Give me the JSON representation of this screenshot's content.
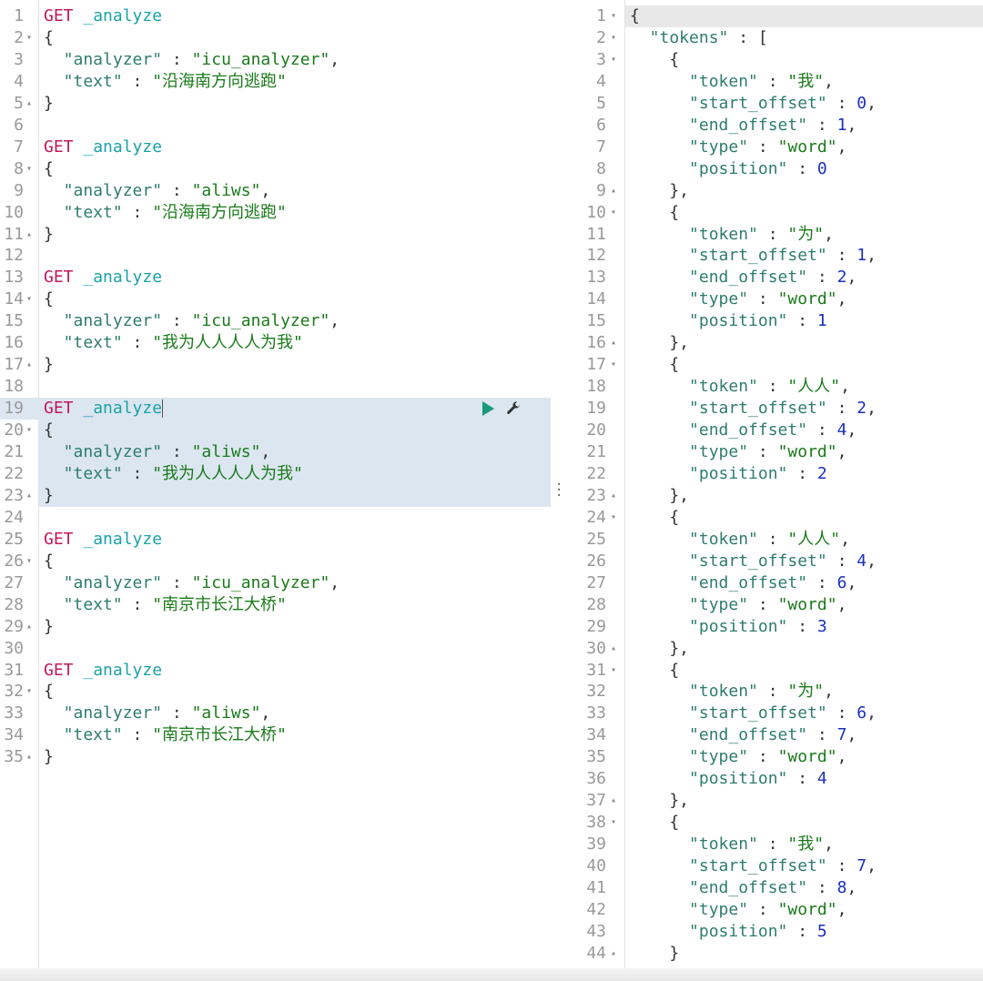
{
  "left_lines": [
    {
      "n": "1",
      "f": "",
      "t": [
        [
          "GET",
          "k-method"
        ],
        [
          " _analyze",
          "k-url"
        ]
      ]
    },
    {
      "n": "2",
      "f": "▾",
      "t": [
        [
          "{",
          "k-punc"
        ]
      ]
    },
    {
      "n": "3",
      "f": "",
      "t": [
        [
          "  \"analyzer\"",
          "k-key"
        ],
        [
          " : ",
          "k-punc"
        ],
        [
          "\"icu_analyzer\"",
          "k-str"
        ],
        [
          ",",
          "k-punc"
        ]
      ]
    },
    {
      "n": "4",
      "f": "",
      "t": [
        [
          "  \"text\"",
          "k-key"
        ],
        [
          " : ",
          "k-punc"
        ],
        [
          "\"沿海南方向逃跑\"",
          "k-str"
        ]
      ]
    },
    {
      "n": "5",
      "f": "▴",
      "t": [
        [
          "}",
          "k-punc"
        ]
      ]
    },
    {
      "n": "6",
      "f": "",
      "t": []
    },
    {
      "n": "7",
      "f": "",
      "t": [
        [
          "GET",
          "k-method"
        ],
        [
          " _analyze",
          "k-url"
        ]
      ]
    },
    {
      "n": "8",
      "f": "▾",
      "t": [
        [
          "{",
          "k-punc"
        ]
      ]
    },
    {
      "n": "9",
      "f": "",
      "t": [
        [
          "  \"analyzer\"",
          "k-key"
        ],
        [
          " : ",
          "k-punc"
        ],
        [
          "\"aliws\"",
          "k-str"
        ],
        [
          ",",
          "k-punc"
        ]
      ]
    },
    {
      "n": "10",
      "f": "",
      "t": [
        [
          "  \"text\"",
          "k-key"
        ],
        [
          " : ",
          "k-punc"
        ],
        [
          "\"沿海南方向逃跑\"",
          "k-str"
        ]
      ]
    },
    {
      "n": "11",
      "f": "▴",
      "t": [
        [
          "}",
          "k-punc"
        ]
      ]
    },
    {
      "n": "12",
      "f": "",
      "t": []
    },
    {
      "n": "13",
      "f": "",
      "t": [
        [
          "GET",
          "k-method"
        ],
        [
          " _analyze",
          "k-url"
        ]
      ]
    },
    {
      "n": "14",
      "f": "▾",
      "t": [
        [
          "{",
          "k-punc"
        ]
      ]
    },
    {
      "n": "15",
      "f": "",
      "t": [
        [
          "  \"analyzer\"",
          "k-key"
        ],
        [
          " : ",
          "k-punc"
        ],
        [
          "\"icu_analyzer\"",
          "k-str"
        ],
        [
          ",",
          "k-punc"
        ]
      ]
    },
    {
      "n": "16",
      "f": "",
      "t": [
        [
          "  \"text\"",
          "k-key"
        ],
        [
          " : ",
          "k-punc"
        ],
        [
          "\"我为人人人人为我\"",
          "k-str"
        ]
      ]
    },
    {
      "n": "17",
      "f": "▴",
      "t": [
        [
          "}",
          "k-punc"
        ]
      ]
    },
    {
      "n": "18",
      "f": "",
      "t": []
    },
    {
      "n": "19",
      "f": "",
      "t": [
        [
          "GET",
          "k-method"
        ],
        [
          " _analyze",
          "k-url"
        ]
      ],
      "cursor": true
    },
    {
      "n": "20",
      "f": "▾",
      "t": [
        [
          "{",
          "k-punc"
        ]
      ]
    },
    {
      "n": "21",
      "f": "",
      "t": [
        [
          "  \"analyzer\"",
          "k-key"
        ],
        [
          " : ",
          "k-punc"
        ],
        [
          "\"aliws\"",
          "k-str"
        ],
        [
          ",",
          "k-punc"
        ]
      ]
    },
    {
      "n": "22",
      "f": "",
      "t": [
        [
          "  \"text\"",
          "k-key"
        ],
        [
          " : ",
          "k-punc"
        ],
        [
          "\"我为人人人人为我\"",
          "k-str"
        ]
      ]
    },
    {
      "n": "23",
      "f": "▴",
      "t": [
        [
          "}",
          "k-punc"
        ]
      ]
    },
    {
      "n": "24",
      "f": "",
      "t": []
    },
    {
      "n": "25",
      "f": "",
      "t": [
        [
          "GET",
          "k-method"
        ],
        [
          " _analyze",
          "k-url"
        ]
      ]
    },
    {
      "n": "26",
      "f": "▾",
      "t": [
        [
          "{",
          "k-punc"
        ]
      ]
    },
    {
      "n": "27",
      "f": "",
      "t": [
        [
          "  \"analyzer\"",
          "k-key"
        ],
        [
          " : ",
          "k-punc"
        ],
        [
          "\"icu_analyzer\"",
          "k-str"
        ],
        [
          ",",
          "k-punc"
        ]
      ]
    },
    {
      "n": "28",
      "f": "",
      "t": [
        [
          "  \"text\"",
          "k-key"
        ],
        [
          " : ",
          "k-punc"
        ],
        [
          "\"南京市长江大桥\"",
          "k-str"
        ]
      ]
    },
    {
      "n": "29",
      "f": "▴",
      "t": [
        [
          "}",
          "k-punc"
        ]
      ]
    },
    {
      "n": "30",
      "f": "",
      "t": []
    },
    {
      "n": "31",
      "f": "",
      "t": [
        [
          "GET",
          "k-method"
        ],
        [
          " _analyze",
          "k-url"
        ]
      ]
    },
    {
      "n": "32",
      "f": "▾",
      "t": [
        [
          "{",
          "k-punc"
        ]
      ]
    },
    {
      "n": "33",
      "f": "",
      "t": [
        [
          "  \"analyzer\"",
          "k-key"
        ],
        [
          " : ",
          "k-punc"
        ],
        [
          "\"aliws\"",
          "k-str"
        ],
        [
          ",",
          "k-punc"
        ]
      ]
    },
    {
      "n": "34",
      "f": "",
      "t": [
        [
          "  \"text\"",
          "k-key"
        ],
        [
          " : ",
          "k-punc"
        ],
        [
          "\"南京市长江大桥\"",
          "k-str"
        ]
      ]
    },
    {
      "n": "35",
      "f": "▴",
      "t": [
        [
          "}",
          "k-punc"
        ]
      ]
    }
  ],
  "right_lines": [
    {
      "n": "1",
      "f": "▾",
      "t": [
        [
          "{",
          "k-punc"
        ]
      ]
    },
    {
      "n": "2",
      "f": "▾",
      "t": [
        [
          "  \"tokens\"",
          "k-key"
        ],
        [
          " : [",
          "k-punc"
        ]
      ]
    },
    {
      "n": "3",
      "f": "▾",
      "t": [
        [
          "    {",
          "k-punc"
        ]
      ]
    },
    {
      "n": "4",
      "f": "",
      "t": [
        [
          "      \"token\"",
          "k-key"
        ],
        [
          " : ",
          "k-punc"
        ],
        [
          "\"我\"",
          "k-str"
        ],
        [
          ",",
          "k-punc"
        ]
      ]
    },
    {
      "n": "5",
      "f": "",
      "t": [
        [
          "      \"start_offset\"",
          "k-key"
        ],
        [
          " : ",
          "k-punc"
        ],
        [
          "0",
          "k-num"
        ],
        [
          ",",
          "k-punc"
        ]
      ]
    },
    {
      "n": "6",
      "f": "",
      "t": [
        [
          "      \"end_offset\"",
          "k-key"
        ],
        [
          " : ",
          "k-punc"
        ],
        [
          "1",
          "k-num"
        ],
        [
          ",",
          "k-punc"
        ]
      ]
    },
    {
      "n": "7",
      "f": "",
      "t": [
        [
          "      \"type\"",
          "k-key"
        ],
        [
          " : ",
          "k-punc"
        ],
        [
          "\"word\"",
          "k-str"
        ],
        [
          ",",
          "k-punc"
        ]
      ]
    },
    {
      "n": "8",
      "f": "",
      "t": [
        [
          "      \"position\"",
          "k-key"
        ],
        [
          " : ",
          "k-punc"
        ],
        [
          "0",
          "k-num"
        ]
      ]
    },
    {
      "n": "9",
      "f": "▴",
      "t": [
        [
          "    },",
          "k-punc"
        ]
      ]
    },
    {
      "n": "10",
      "f": "▾",
      "t": [
        [
          "    {",
          "k-punc"
        ]
      ]
    },
    {
      "n": "11",
      "f": "",
      "t": [
        [
          "      \"token\"",
          "k-key"
        ],
        [
          " : ",
          "k-punc"
        ],
        [
          "\"为\"",
          "k-str"
        ],
        [
          ",",
          "k-punc"
        ]
      ]
    },
    {
      "n": "12",
      "f": "",
      "t": [
        [
          "      \"start_offset\"",
          "k-key"
        ],
        [
          " : ",
          "k-punc"
        ],
        [
          "1",
          "k-num"
        ],
        [
          ",",
          "k-punc"
        ]
      ]
    },
    {
      "n": "13",
      "f": "",
      "t": [
        [
          "      \"end_offset\"",
          "k-key"
        ],
        [
          " : ",
          "k-punc"
        ],
        [
          "2",
          "k-num"
        ],
        [
          ",",
          "k-punc"
        ]
      ]
    },
    {
      "n": "14",
      "f": "",
      "t": [
        [
          "      \"type\"",
          "k-key"
        ],
        [
          " : ",
          "k-punc"
        ],
        [
          "\"word\"",
          "k-str"
        ],
        [
          ",",
          "k-punc"
        ]
      ]
    },
    {
      "n": "15",
      "f": "",
      "t": [
        [
          "      \"position\"",
          "k-key"
        ],
        [
          " : ",
          "k-punc"
        ],
        [
          "1",
          "k-num"
        ]
      ]
    },
    {
      "n": "16",
      "f": "▴",
      "t": [
        [
          "    },",
          "k-punc"
        ]
      ]
    },
    {
      "n": "17",
      "f": "▾",
      "t": [
        [
          "    {",
          "k-punc"
        ]
      ]
    },
    {
      "n": "18",
      "f": "",
      "t": [
        [
          "      \"token\"",
          "k-key"
        ],
        [
          " : ",
          "k-punc"
        ],
        [
          "\"人人\"",
          "k-str"
        ],
        [
          ",",
          "k-punc"
        ]
      ]
    },
    {
      "n": "19",
      "f": "",
      "t": [
        [
          "      \"start_offset\"",
          "k-key"
        ],
        [
          " : ",
          "k-punc"
        ],
        [
          "2",
          "k-num"
        ],
        [
          ",",
          "k-punc"
        ]
      ]
    },
    {
      "n": "20",
      "f": "",
      "t": [
        [
          "      \"end_offset\"",
          "k-key"
        ],
        [
          " : ",
          "k-punc"
        ],
        [
          "4",
          "k-num"
        ],
        [
          ",",
          "k-punc"
        ]
      ]
    },
    {
      "n": "21",
      "f": "",
      "t": [
        [
          "      \"type\"",
          "k-key"
        ],
        [
          " : ",
          "k-punc"
        ],
        [
          "\"word\"",
          "k-str"
        ],
        [
          ",",
          "k-punc"
        ]
      ]
    },
    {
      "n": "22",
      "f": "",
      "t": [
        [
          "      \"position\"",
          "k-key"
        ],
        [
          " : ",
          "k-punc"
        ],
        [
          "2",
          "k-num"
        ]
      ]
    },
    {
      "n": "23",
      "f": "▴",
      "t": [
        [
          "    },",
          "k-punc"
        ]
      ]
    },
    {
      "n": "24",
      "f": "▾",
      "t": [
        [
          "    {",
          "k-punc"
        ]
      ]
    },
    {
      "n": "25",
      "f": "",
      "t": [
        [
          "      \"token\"",
          "k-key"
        ],
        [
          " : ",
          "k-punc"
        ],
        [
          "\"人人\"",
          "k-str"
        ],
        [
          ",",
          "k-punc"
        ]
      ]
    },
    {
      "n": "26",
      "f": "",
      "t": [
        [
          "      \"start_offset\"",
          "k-key"
        ],
        [
          " : ",
          "k-punc"
        ],
        [
          "4",
          "k-num"
        ],
        [
          ",",
          "k-punc"
        ]
      ]
    },
    {
      "n": "27",
      "f": "",
      "t": [
        [
          "      \"end_offset\"",
          "k-key"
        ],
        [
          " : ",
          "k-punc"
        ],
        [
          "6",
          "k-num"
        ],
        [
          ",",
          "k-punc"
        ]
      ]
    },
    {
      "n": "28",
      "f": "",
      "t": [
        [
          "      \"type\"",
          "k-key"
        ],
        [
          " : ",
          "k-punc"
        ],
        [
          "\"word\"",
          "k-str"
        ],
        [
          ",",
          "k-punc"
        ]
      ]
    },
    {
      "n": "29",
      "f": "",
      "t": [
        [
          "      \"position\"",
          "k-key"
        ],
        [
          " : ",
          "k-punc"
        ],
        [
          "3",
          "k-num"
        ]
      ]
    },
    {
      "n": "30",
      "f": "▴",
      "t": [
        [
          "    },",
          "k-punc"
        ]
      ]
    },
    {
      "n": "31",
      "f": "▾",
      "t": [
        [
          "    {",
          "k-punc"
        ]
      ]
    },
    {
      "n": "32",
      "f": "",
      "t": [
        [
          "      \"token\"",
          "k-key"
        ],
        [
          " : ",
          "k-punc"
        ],
        [
          "\"为\"",
          "k-str"
        ],
        [
          ",",
          "k-punc"
        ]
      ]
    },
    {
      "n": "33",
      "f": "",
      "t": [
        [
          "      \"start_offset\"",
          "k-key"
        ],
        [
          " : ",
          "k-punc"
        ],
        [
          "6",
          "k-num"
        ],
        [
          ",",
          "k-punc"
        ]
      ]
    },
    {
      "n": "34",
      "f": "",
      "t": [
        [
          "      \"end_offset\"",
          "k-key"
        ],
        [
          " : ",
          "k-punc"
        ],
        [
          "7",
          "k-num"
        ],
        [
          ",",
          "k-punc"
        ]
      ]
    },
    {
      "n": "35",
      "f": "",
      "t": [
        [
          "      \"type\"",
          "k-key"
        ],
        [
          " : ",
          "k-punc"
        ],
        [
          "\"word\"",
          "k-str"
        ],
        [
          ",",
          "k-punc"
        ]
      ]
    },
    {
      "n": "36",
      "f": "",
      "t": [
        [
          "      \"position\"",
          "k-key"
        ],
        [
          " : ",
          "k-punc"
        ],
        [
          "4",
          "k-num"
        ]
      ]
    },
    {
      "n": "37",
      "f": "▴",
      "t": [
        [
          "    },",
          "k-punc"
        ]
      ]
    },
    {
      "n": "38",
      "f": "▾",
      "t": [
        [
          "    {",
          "k-punc"
        ]
      ]
    },
    {
      "n": "39",
      "f": "",
      "t": [
        [
          "      \"token\"",
          "k-key"
        ],
        [
          " : ",
          "k-punc"
        ],
        [
          "\"我\"",
          "k-str"
        ],
        [
          ",",
          "k-punc"
        ]
      ]
    },
    {
      "n": "40",
      "f": "",
      "t": [
        [
          "      \"start_offset\"",
          "k-key"
        ],
        [
          " : ",
          "k-punc"
        ],
        [
          "7",
          "k-num"
        ],
        [
          ",",
          "k-punc"
        ]
      ]
    },
    {
      "n": "41",
      "f": "",
      "t": [
        [
          "      \"end_offset\"",
          "k-key"
        ],
        [
          " : ",
          "k-punc"
        ],
        [
          "8",
          "k-num"
        ],
        [
          ",",
          "k-punc"
        ]
      ]
    },
    {
      "n": "42",
      "f": "",
      "t": [
        [
          "      \"type\"",
          "k-key"
        ],
        [
          " : ",
          "k-punc"
        ],
        [
          "\"word\"",
          "k-str"
        ],
        [
          ",",
          "k-punc"
        ]
      ]
    },
    {
      "n": "43",
      "f": "",
      "t": [
        [
          "      \"position\"",
          "k-key"
        ],
        [
          " : ",
          "k-punc"
        ],
        [
          "5",
          "k-num"
        ]
      ]
    },
    {
      "n": "44",
      "f": "▴",
      "t": [
        [
          "    }",
          "k-punc"
        ]
      ]
    }
  ],
  "icons": {
    "run": "play-icon",
    "settings": "wrench-icon"
  },
  "colors": {
    "selection": "#dce6f0",
    "method": "#c2185b",
    "url": "#1aa2a8",
    "key": "#2f7d6d",
    "string": "#1a7a1a",
    "number": "#1a2fbf"
  }
}
